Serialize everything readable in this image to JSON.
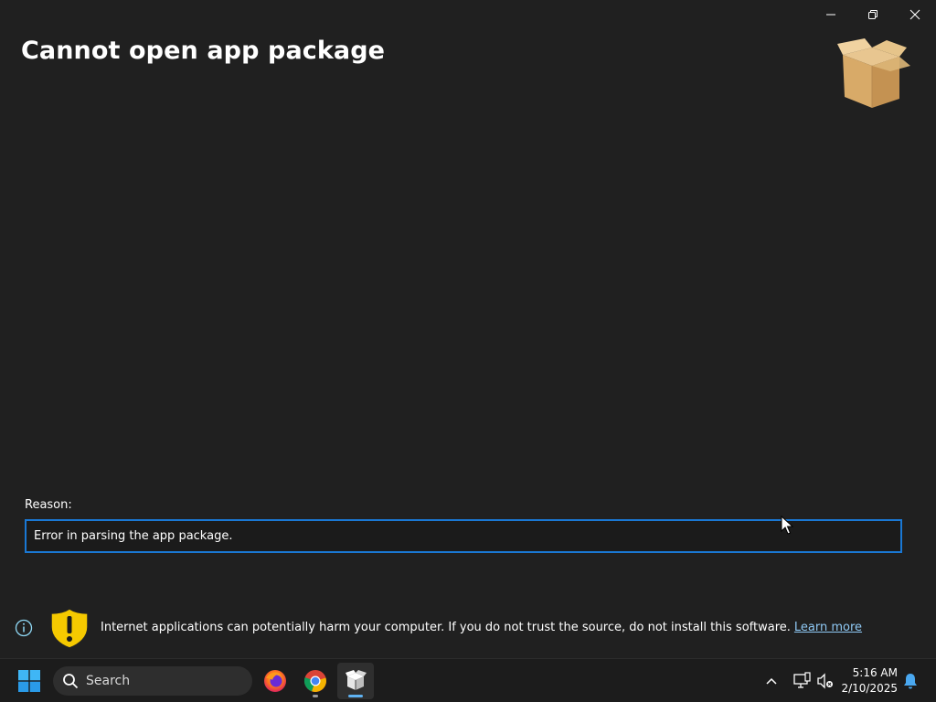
{
  "window": {
    "title": "Cannot open app package",
    "caption_buttons": {
      "minimize": "minimize-icon",
      "maximize": "restore-icon",
      "close": "close-icon"
    }
  },
  "reason": {
    "label": "Reason:",
    "value": "Error in parsing the app package."
  },
  "warning": {
    "text": "Internet applications can potentially harm your computer. If you do not trust the source, do not install this software.",
    "link": "Learn more"
  },
  "taskbar": {
    "search_placeholder": "Search",
    "apps": [
      "firefox-icon",
      "chrome-icon",
      "app-installer-icon"
    ],
    "time": "5:16 AM",
    "date": "2/10/2025"
  },
  "colors": {
    "background": "#202020",
    "accent": "#1a78d4",
    "link": "#8fc9f5",
    "shield": "#f5c900"
  }
}
